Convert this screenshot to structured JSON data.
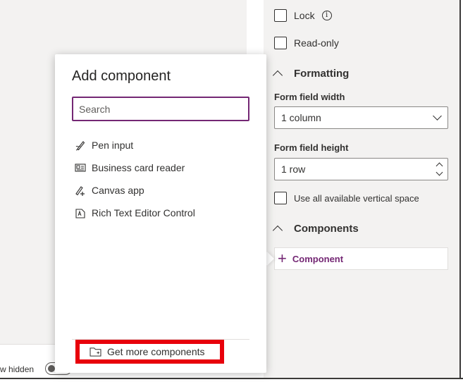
{
  "right_panel": {
    "lock_label": "Lock",
    "readonly_label": "Read-only",
    "formatting_header": "Formatting",
    "form_field_width_label": "Form field width",
    "form_field_width_value": "1 column",
    "form_field_height_label": "Form field height",
    "form_field_height_value": "1 row",
    "use_vertical_space_label": "Use all available vertical space",
    "components_header": "Components",
    "component_button_label": "Component"
  },
  "flyout": {
    "title": "Add component",
    "search_placeholder": "Search",
    "items": [
      {
        "label": "Pen input",
        "icon": "pen-icon"
      },
      {
        "label": "Business card reader",
        "icon": "business-card-icon"
      },
      {
        "label": "Canvas app",
        "icon": "canvas-app-icon"
      },
      {
        "label": "Rich Text Editor Control",
        "icon": "rich-text-icon"
      }
    ],
    "get_more_label": "Get more components",
    "highlight_color": "#e8000b"
  },
  "bottom_bar": {
    "show_hidden_label": "w hidden"
  },
  "colors": {
    "accent": "#742774",
    "panel_bg": "#f3f2f1"
  }
}
